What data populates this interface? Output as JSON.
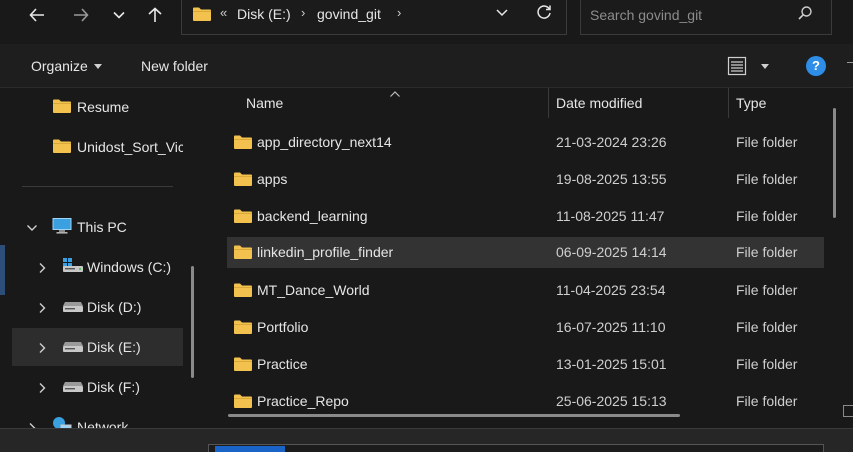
{
  "window": {
    "title": "govind_git"
  },
  "nav_buttons": {
    "back_icon": "back-arrow-icon",
    "forward_icon": "forward-arrow-icon",
    "recent_icon": "chevron-down-icon",
    "up_icon": "up-arrow-icon"
  },
  "address": {
    "overflow": "«",
    "crumbs": [
      "Disk (E:)",
      "govind_git"
    ],
    "separator": "›"
  },
  "search": {
    "placeholder": "Search govind_git"
  },
  "toolbar": {
    "organize_label": "Organize",
    "new_folder_label": "New folder",
    "help_label": "?"
  },
  "nav_pane": {
    "items": [
      {
        "label": "Resume",
        "icon": "folder-icon"
      },
      {
        "label": "Unidost_Sort_Vic",
        "icon": "folder-icon"
      },
      {
        "label": "This PC",
        "icon": "computer-icon"
      },
      {
        "label": "Windows (C:)",
        "icon": "windows-drive-icon"
      },
      {
        "label": "Disk (D:)",
        "icon": "drive-icon"
      },
      {
        "label": "Disk (E:)",
        "icon": "drive-icon",
        "selected": true
      },
      {
        "label": "Disk (F:)",
        "icon": "drive-icon"
      },
      {
        "label": "Network",
        "icon": "network-icon"
      }
    ]
  },
  "columns": {
    "name": "Name",
    "date": "Date modified",
    "type": "Type"
  },
  "files": [
    {
      "name": "app_directory_next14",
      "date": "21-03-2024 23:26",
      "type": "File folder"
    },
    {
      "name": "apps",
      "date": "19-08-2025 13:55",
      "type": "File folder"
    },
    {
      "name": "backend_learning",
      "date": "11-08-2025 11:47",
      "type": "File folder"
    },
    {
      "name": "linkedin_profile_finder",
      "date": "06-09-2025 14:14",
      "type": "File folder",
      "hover": true
    },
    {
      "name": "MT_Dance_World",
      "date": "11-04-2025 23:54",
      "type": "File folder"
    },
    {
      "name": "Portfolio",
      "date": "16-07-2025 11:10",
      "type": "File folder"
    },
    {
      "name": "Practice",
      "date": "13-01-2025 15:01",
      "type": "File folder"
    },
    {
      "name": "Practice_Repo",
      "date": "25-06-2025 15:13",
      "type": "File folder"
    }
  ],
  "colors": {
    "background": "#191919",
    "folder": "#f2c14e",
    "accent": "#2e8de6",
    "hover_row": "#333333"
  }
}
